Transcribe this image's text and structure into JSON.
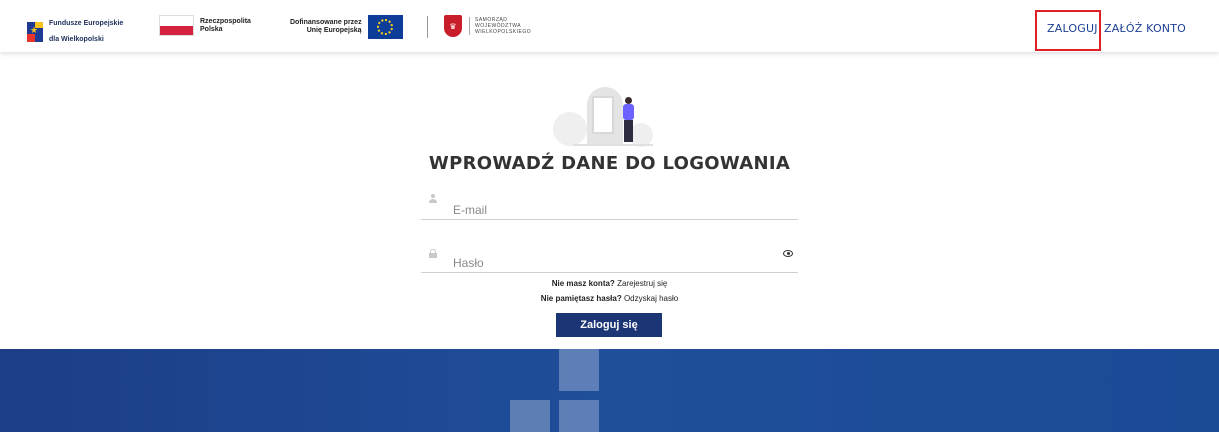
{
  "header": {
    "fe_logo": {
      "line1": "Fundusze Europejskie",
      "line2": "dla Wielkopolski"
    },
    "rp_logo": {
      "line1": "Rzeczpospolita",
      "line2": "Polska"
    },
    "eu_logo": {
      "line1": "Dofinansowane przez",
      "line2": "Unię Europejską"
    },
    "sw_logo": {
      "line1": "SAMORZĄD",
      "line2": "WOJEWÓDZTWA",
      "line3": "WIELKOPOLSKIEGO"
    },
    "nav": {
      "login": "ZALOGUJ",
      "register": "ZAŁÓŻ KONTO"
    }
  },
  "main": {
    "title": "WPROWADŹ DANE DO LOGOWANIA",
    "email_placeholder": "E-mail",
    "password_placeholder": "Hasło",
    "no_account_text": "Nie masz konta?",
    "register_link": "Zarejestruj się",
    "forgot_text": "Nie pamiętasz hasła?",
    "recover_link": "Odzyskaj hasło",
    "submit_label": "Zaloguj się"
  },
  "icons": {
    "email": "user-icon",
    "password": "lock-icon",
    "show_password": "eye-icon"
  },
  "colors": {
    "brand_blue": "#1c3575",
    "link_blue": "#1c3f94",
    "highlight_red": "#e02027",
    "footer_blue": "#1f4e9b"
  }
}
